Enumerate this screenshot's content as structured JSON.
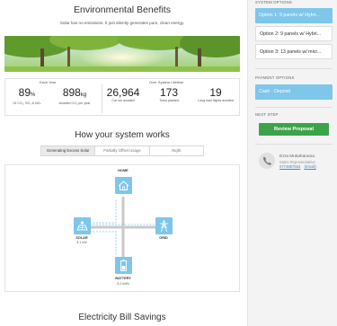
{
  "environmental": {
    "title": "Environmental Benefits",
    "subtitle": "Solar has no emissions. It just silently generates pure, clean energy.",
    "each_year_label": "Each Year",
    "lifetime_label": "Over System Lifetime",
    "stats": [
      {
        "value": "89",
        "unit": "%",
        "label": "Of CO₂, SO₂ & NOₓ"
      },
      {
        "value": "898",
        "unit": "kg",
        "label": "Avoided CO₂ per year"
      },
      {
        "value": "26,964",
        "unit": "",
        "label": "Car km avoided"
      },
      {
        "value": "173",
        "unit": "",
        "label": "Trees planted"
      },
      {
        "value": "19",
        "unit": "",
        "label": "Long haul flights avoided"
      }
    ]
  },
  "how_it_works": {
    "title": "How your system works",
    "tabs": [
      "Generating Excess Solar",
      "Partially Offset Usage",
      "Night"
    ],
    "active_tab": 0,
    "nodes": {
      "home": {
        "label": "HOME"
      },
      "solar": {
        "label": "SOLAR",
        "value": "4.1 kW"
      },
      "grid": {
        "label": "GRID"
      },
      "battery": {
        "label": "BATTERY",
        "value": "5.2 kWh"
      }
    }
  },
  "bill": {
    "title": "Electricity Bill Savings"
  },
  "sidebar": {
    "system_options_label": "SYSTEM OPTIONS",
    "options": [
      {
        "label": "Option 1: 9 panels w/ Hybri...",
        "selected": true
      },
      {
        "label": "Option 2: 9 panels w/ Hybri...",
        "selected": false
      },
      {
        "label": "Option 3: 13 panels w/ micr...",
        "selected": false
      }
    ],
    "payment_label": "PAYMENT OPTIONS",
    "payment_option": "Cash - Deposit",
    "next_step_label": "NEXT STEP",
    "review_button": "Review Proposal",
    "rep": {
      "name": "Ezra Mukahanana",
      "title": "Sales Representative",
      "phone": "0774887553",
      "email_link": "(Email)"
    }
  },
  "colors": {
    "accent": "#7ec6ea",
    "green": "#3da34a"
  }
}
